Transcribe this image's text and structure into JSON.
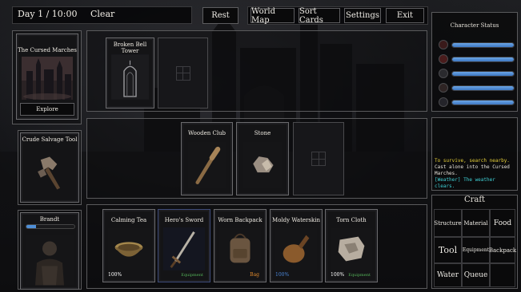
{
  "topbar": {
    "day_time": "Day 1 / 10:00",
    "weather": "Clear",
    "rest_label": "Rest",
    "world_map_label": "World Map",
    "sort_cards_label": "Sort Cards",
    "settings_label": "Settings",
    "exit_label": "Exit"
  },
  "location": {
    "title": "The Cursed Marches",
    "explore_label": "Explore"
  },
  "tool_card": {
    "title": "Crude Salvage Tool"
  },
  "character_card": {
    "title": "Brandt",
    "bar_fill": 0.2
  },
  "discovery_row": [
    {
      "title": "Broken Bell Tower"
    }
  ],
  "field_row": [
    {
      "title": "Wooden Club"
    },
    {
      "title": "Stone"
    }
  ],
  "inventory": [
    {
      "title": "Calming Tea",
      "pct": "100%",
      "tag": ""
    },
    {
      "title": "Hero's Sword",
      "pct": "",
      "tag": "Equipment"
    },
    {
      "title": "Worn Backpack",
      "pct": "",
      "tag": "Bag"
    },
    {
      "title": "Moldy Waterskin",
      "pct": "100%",
      "tag": ""
    },
    {
      "title": "Torn Cloth",
      "pct": "100%",
      "tag": "Equipment"
    }
  ],
  "status": {
    "title": "Character Status",
    "bars": [
      {
        "icon": "heart-icon",
        "fill": 1.0
      },
      {
        "icon": "stomach-icon",
        "fill": 1.0
      },
      {
        "icon": "water-drop-icon",
        "fill": 1.0
      },
      {
        "icon": "brain-icon",
        "fill": 1.0
      },
      {
        "icon": "shield-icon",
        "fill": 1.0
      }
    ]
  },
  "log": {
    "line1": "To survive, search nearby.",
    "line2": "Cast alone into the Cursed Marches.",
    "line3": "[Weather] The weather clears."
  },
  "craft": {
    "title": "Craft",
    "structure": "Structure",
    "material": "Material",
    "food": "Food",
    "tool": "Tool",
    "equipment": "Equipment",
    "backpack": "Backpack",
    "water": "Water",
    "queue": "Queue"
  },
  "colors": {
    "accent_blue": "#4f8fd8",
    "log_yellow": "#e8d23a",
    "log_cyan": "#3fd1d6",
    "tag_green": "#55b55a",
    "tag_orange": "#e28a2c",
    "pct_blue": "#4a86d8"
  }
}
